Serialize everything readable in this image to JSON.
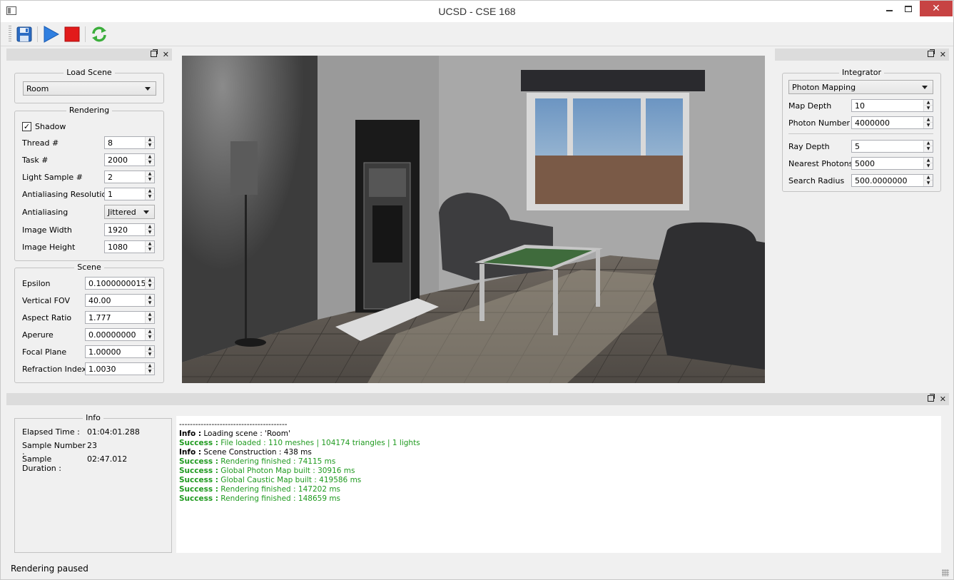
{
  "window": {
    "title": "UCSD - CSE 168"
  },
  "toolbar": {
    "buttons": [
      {
        "icon": "save-icon"
      },
      {
        "icon": "play-icon"
      },
      {
        "icon": "stop-icon"
      },
      {
        "icon": "refresh-icon"
      }
    ]
  },
  "left": {
    "load_scene": {
      "title": "Load Scene",
      "value": "Room"
    },
    "rendering": {
      "title": "Rendering",
      "shadow_label": "Shadow",
      "shadow_checked": true,
      "fields": [
        {
          "label": "Thread #",
          "value": "8"
        },
        {
          "label": "Task #",
          "value": "2000"
        },
        {
          "label": "Light Sample #",
          "value": "2"
        },
        {
          "label": "Antialiasing Resolution",
          "value": "1"
        },
        {
          "label": "Antialiasing",
          "value": "Jittered"
        },
        {
          "label": "Image Width",
          "value": "1920"
        },
        {
          "label": "Image Height",
          "value": "1080"
        }
      ]
    },
    "scene": {
      "title": "Scene",
      "fields": [
        {
          "label": "Epsilon",
          "value": "0.1000000015"
        },
        {
          "label": "Vertical FOV",
          "value": "40.00"
        },
        {
          "label": "Aspect Ratio",
          "value": "1.777"
        },
        {
          "label": "Aperure",
          "value": "0.00000000"
        },
        {
          "label": "Focal Plane",
          "value": "1.00000"
        },
        {
          "label": "Refraction Index",
          "value": "1.0030"
        }
      ]
    }
  },
  "right": {
    "integrator": {
      "title": "Integrator",
      "value": "Photon Mapping",
      "fields": [
        {
          "label": "Map Depth",
          "value": "10"
        },
        {
          "label": "Photon Number",
          "value": "4000000"
        },
        {
          "label": "Ray Depth",
          "value": "5"
        },
        {
          "label": "Nearest Photons",
          "value": "5000"
        },
        {
          "label": "Search Radius",
          "value": "500.0000000"
        }
      ]
    }
  },
  "info": {
    "title": "Info",
    "rows": [
      {
        "label": "Elapsed Time :",
        "value": "01:04:01.288"
      },
      {
        "label": "Sample Number :",
        "value": "23"
      },
      {
        "label": "Sample Duration :",
        "value": "02:47.012"
      }
    ]
  },
  "log": {
    "separator": "----------------------------------------",
    "lines": [
      {
        "type": "info",
        "tag": "Info :",
        "text": " Loading scene : 'Room'"
      },
      {
        "type": "ok",
        "tag": "Success :",
        "text": " File loaded : 110 meshes | 104174 triangles | 1 lights"
      },
      {
        "type": "info",
        "tag": "Info :",
        "text": " Scene Construction : 438 ms"
      },
      {
        "type": "ok",
        "tag": "Success :",
        "text": " Rendering finished : 74115 ms"
      },
      {
        "type": "ok",
        "tag": "Success :",
        "text": " Global Photon Map built : 30916 ms"
      },
      {
        "type": "ok",
        "tag": "Success :",
        "text": " Global Caustic Map built : 419586 ms"
      },
      {
        "type": "ok",
        "tag": "Success :",
        "text": " Rendering finished : 147202 ms"
      },
      {
        "type": "ok",
        "tag": "Success :",
        "text": " Rendering finished : 148659 ms"
      }
    ]
  },
  "status": {
    "text": "Rendering paused"
  },
  "colors": {
    "success": "#1f9a1f",
    "close_button": "#c74343"
  }
}
